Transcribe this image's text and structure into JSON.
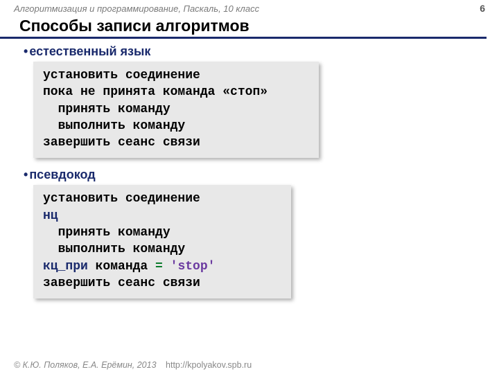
{
  "header": {
    "course": "Алгоритмизация и программирование, Паскаль, 10 класс",
    "page": "6"
  },
  "title": "Способы записи алгоритмов",
  "sections": {
    "s1": {
      "label": "естественный язык",
      "lines": {
        "l1": "установить соединение",
        "l2": "пока не принята команда «стоп»",
        "l3": "  принять команду",
        "l4": "  выполнить команду",
        "l5": "завершить сеанс связи"
      }
    },
    "s2": {
      "label": "псевдокод",
      "lines": {
        "l1": "установить соединение",
        "kw_nc": "нц",
        "l3": "  принять команду",
        "l4": "  выполнить команду",
        "kw_kc": "кц_при",
        "cond_word": " команда ",
        "eq": "=",
        "str": " 'stop'",
        "l6": "завершить сеанс связи"
      }
    }
  },
  "footer": {
    "copyright": "© К.Ю. Поляков, Е.А. Ерёмин, 2013",
    "link": "http://kpolyakov.spb.ru"
  }
}
